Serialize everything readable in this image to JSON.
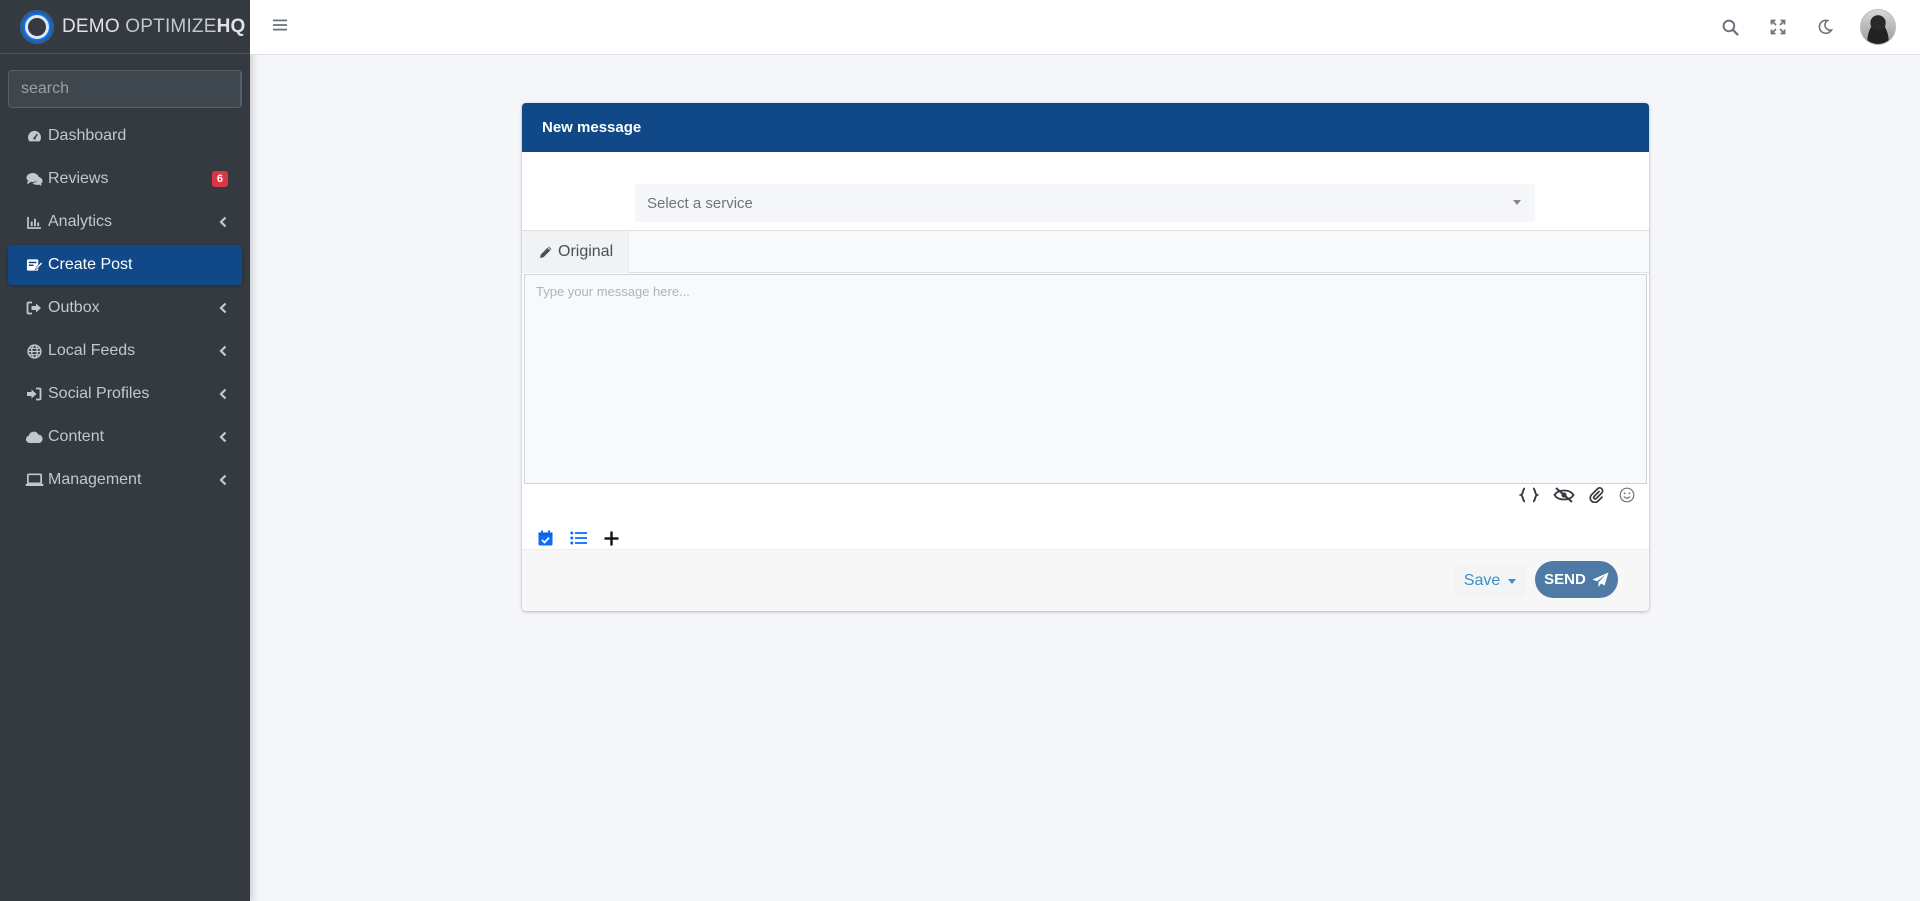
{
  "brand": {
    "part1": "DEMO ",
    "part2": "OPTIMIZE",
    "part3": "HQ"
  },
  "sidebar": {
    "search_placeholder": "search",
    "items": [
      {
        "label": "Dashboard",
        "icon": "dashboard-icon"
      },
      {
        "label": "Reviews",
        "icon": "comments-icon",
        "badge": "6"
      },
      {
        "label": "Analytics",
        "icon": "bar-chart-icon"
      },
      {
        "label": "Create Post",
        "icon": "create-post-icon",
        "active": true
      },
      {
        "label": "Outbox",
        "icon": "sign-out-icon"
      },
      {
        "label": "Local Feeds",
        "icon": "globe-icon"
      },
      {
        "label": "Social Profiles",
        "icon": "sign-in-icon"
      },
      {
        "label": "Content",
        "icon": "cloud-icon"
      },
      {
        "label": "Management",
        "icon": "laptop-icon"
      }
    ]
  },
  "card": {
    "title": "New message",
    "service_placeholder": "Select a service",
    "tab_label": "Original",
    "message_placeholder": "Type your message here...",
    "save_label": "Save",
    "send_label": "SEND"
  },
  "colors": {
    "sidebar_bg": "#343a40",
    "accent": "#114887",
    "badge": "#dc3545",
    "send": "#4f7aa6",
    "link": "#3d8fc4"
  }
}
